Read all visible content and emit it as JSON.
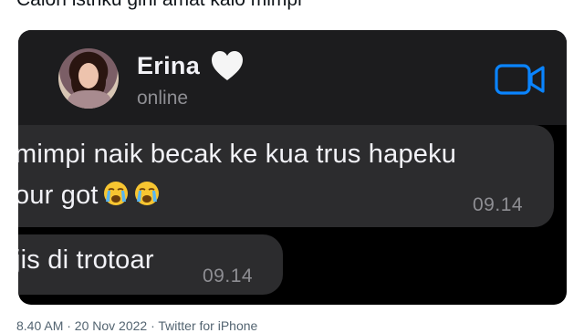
{
  "tweet": {
    "text": "Calon istriku gini amat kalo mimpi",
    "meta": "8.40 AM · 20 Nov 2022 · Twitter for iPhone"
  },
  "chat": {
    "contact_name": "Erina",
    "heart_icon": "white-heart-icon",
    "status": "online",
    "video_icon": "video-camera-icon",
    "accent_color": "#0a84ff",
    "messages": [
      {
        "lines": [
          "mimpi naik becak ke kua trus hapeku",
          "our got"
        ],
        "emojis": [
          "loudly-crying-face-icon",
          "loudly-crying-face-icon"
        ],
        "time": "09.14"
      },
      {
        "lines": [
          "jis di trotoar"
        ],
        "time": "09.14"
      }
    ]
  }
}
